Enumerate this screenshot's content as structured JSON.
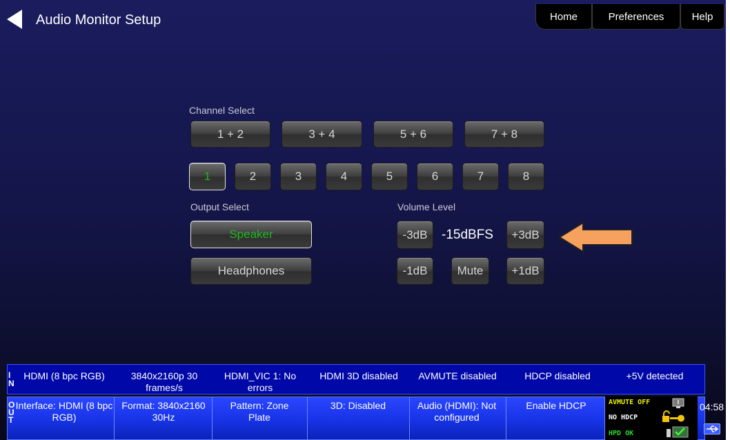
{
  "header": {
    "title": "Audio Monitor Setup",
    "tabs": {
      "home": "Home",
      "preferences": "Preferences",
      "help": "Help"
    }
  },
  "channel_select": {
    "label": "Channel Select",
    "pairs": [
      "1 + 2",
      "3 + 4",
      "5 + 6",
      "7 + 8"
    ],
    "channels": [
      "1",
      "2",
      "3",
      "4",
      "5",
      "6",
      "7",
      "8"
    ],
    "active_channel": "1"
  },
  "output_select": {
    "label": "Output Select",
    "speaker": "Speaker",
    "headphones": "Headphones",
    "active": "Speaker"
  },
  "volume": {
    "label": "Volume Level",
    "value": "-15dBFS",
    "minus3": "-3dB",
    "plus3": "+3dB",
    "minus1": "-1dB",
    "mute": "Mute",
    "plus1": "+1dB"
  },
  "in_bar": {
    "side": [
      "I",
      "N"
    ],
    "cells": [
      "HDMI (8 bpc RGB)",
      "3840x2160p 30 frames/s",
      "HDMI_VIC 1: No errors",
      "HDMI 3D disabled",
      "AVMUTE disabled",
      "HDCP disabled",
      "+5V detected"
    ]
  },
  "out_bar": {
    "side": [
      "O",
      "U",
      "T"
    ],
    "cells": [
      "Interface: HDMI (8 bpc RGB)",
      "Format: 3840x2160 30Hz",
      "Pattern: Zone Plate",
      "3D: Disabled",
      "Audio (HDMI): Not configured",
      "Enable HDCP"
    ]
  },
  "status_panel": {
    "avmute": "AVMUTE OFF",
    "hdcp": "NO HDCP",
    "hpd": "HPD OK"
  },
  "clock": "04:58",
  "colors": {
    "active_green": "#22b41f",
    "arrow_orange": "#f7a15e",
    "in_bar": "#0008a8",
    "out_bar": "#1733e6",
    "status_yellow": "#e8f000",
    "status_green": "#2cd82c"
  },
  "icons": [
    "back-arrow-icon",
    "lock-key-icon",
    "monitor-icon",
    "check-icon",
    "usb-icon"
  ]
}
